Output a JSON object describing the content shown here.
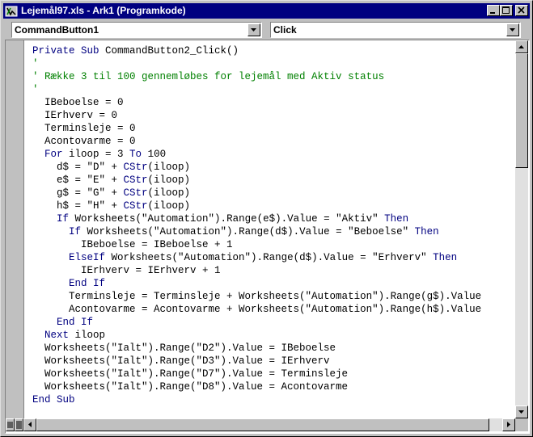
{
  "window": {
    "title": "Lejemål97.xls - Ark1 (Programkode)"
  },
  "object_combo": {
    "value": "CommandButton1"
  },
  "procedure_combo": {
    "value": "Click"
  },
  "code_lines": [
    [
      {
        "t": "Private Sub ",
        "c": "kw"
      },
      {
        "t": "CommandButton2_Click()",
        "c": ""
      }
    ],
    [
      {
        "t": "'",
        "c": "cm"
      }
    ],
    [
      {
        "t": "' Række 3 til 100 gennemløbes for lejemål med Aktiv status",
        "c": "cm"
      }
    ],
    [
      {
        "t": "'",
        "c": "cm"
      }
    ],
    [
      {
        "t": "  IBeboelse = 0",
        "c": ""
      }
    ],
    [
      {
        "t": "  IErhverv = 0",
        "c": ""
      }
    ],
    [
      {
        "t": "  Terminsleje = 0",
        "c": ""
      }
    ],
    [
      {
        "t": "  Acontovarme = 0",
        "c": ""
      }
    ],
    [
      {
        "t": "  ",
        "c": ""
      },
      {
        "t": "For",
        "c": "kw"
      },
      {
        "t": " iloop = 3 ",
        "c": ""
      },
      {
        "t": "To",
        "c": "kw"
      },
      {
        "t": " 100",
        "c": ""
      }
    ],
    [
      {
        "t": "    d$ = \"D\" + ",
        "c": ""
      },
      {
        "t": "CStr",
        "c": "kw"
      },
      {
        "t": "(iloop)",
        "c": ""
      }
    ],
    [
      {
        "t": "    e$ = \"E\" + ",
        "c": ""
      },
      {
        "t": "CStr",
        "c": "kw"
      },
      {
        "t": "(iloop)",
        "c": ""
      }
    ],
    [
      {
        "t": "    g$ = \"G\" + ",
        "c": ""
      },
      {
        "t": "CStr",
        "c": "kw"
      },
      {
        "t": "(iloop)",
        "c": ""
      }
    ],
    [
      {
        "t": "    h$ = \"H\" + ",
        "c": ""
      },
      {
        "t": "CStr",
        "c": "kw"
      },
      {
        "t": "(iloop)",
        "c": ""
      }
    ],
    [
      {
        "t": "    ",
        "c": ""
      },
      {
        "t": "If",
        "c": "kw"
      },
      {
        "t": " Worksheets(\"Automation\").Range(e$).Value = \"Aktiv\" ",
        "c": ""
      },
      {
        "t": "Then",
        "c": "kw"
      }
    ],
    [
      {
        "t": "      ",
        "c": ""
      },
      {
        "t": "If",
        "c": "kw"
      },
      {
        "t": " Worksheets(\"Automation\").Range(d$).Value = \"Beboelse\" ",
        "c": ""
      },
      {
        "t": "Then",
        "c": "kw"
      }
    ],
    [
      {
        "t": "        IBeboelse = IBeboelse + 1",
        "c": ""
      }
    ],
    [
      {
        "t": "      ",
        "c": ""
      },
      {
        "t": "ElseIf",
        "c": "kw"
      },
      {
        "t": " Worksheets(\"Automation\").Range(d$).Value = \"Erhverv\" ",
        "c": ""
      },
      {
        "t": "Then",
        "c": "kw"
      }
    ],
    [
      {
        "t": "        IErhverv = IErhverv + 1",
        "c": ""
      }
    ],
    [
      {
        "t": "      ",
        "c": ""
      },
      {
        "t": "End If",
        "c": "kw"
      }
    ],
    [
      {
        "t": "      Terminsleje = Terminsleje + Worksheets(\"Automation\").Range(g$).Value",
        "c": ""
      }
    ],
    [
      {
        "t": "      Acontovarme = Acontovarme + Worksheets(\"Automation\").Range(h$).Value",
        "c": ""
      }
    ],
    [
      {
        "t": "    ",
        "c": ""
      },
      {
        "t": "End If",
        "c": "kw"
      }
    ],
    [
      {
        "t": "  ",
        "c": ""
      },
      {
        "t": "Next",
        "c": "kw"
      },
      {
        "t": " iloop",
        "c": ""
      }
    ],
    [
      {
        "t": "  Worksheets(\"Ialt\").Range(\"D2\").Value = IBeboelse",
        "c": ""
      }
    ],
    [
      {
        "t": "  Worksheets(\"Ialt\").Range(\"D3\").Value = IErhverv",
        "c": ""
      }
    ],
    [
      {
        "t": "  Worksheets(\"Ialt\").Range(\"D7\").Value = Terminsleje",
        "c": ""
      }
    ],
    [
      {
        "t": "  Worksheets(\"Ialt\").Range(\"D8\").Value = Acontovarme",
        "c": ""
      }
    ],
    [
      {
        "t": "End Sub",
        "c": "kw"
      }
    ]
  ],
  "icons": {
    "app": "vba-code-window-icon",
    "minimize": "minimize-icon",
    "maximize": "maximize-icon",
    "close": "close-icon",
    "dropdown": "chevron-down-icon",
    "procedure_view": "procedure-view-icon",
    "full_module_view": "full-module-view-icon"
  },
  "colors": {
    "titlebar": "#000080",
    "keyword": "#000080",
    "comment": "#008000",
    "chrome": "#c0c0c0"
  }
}
